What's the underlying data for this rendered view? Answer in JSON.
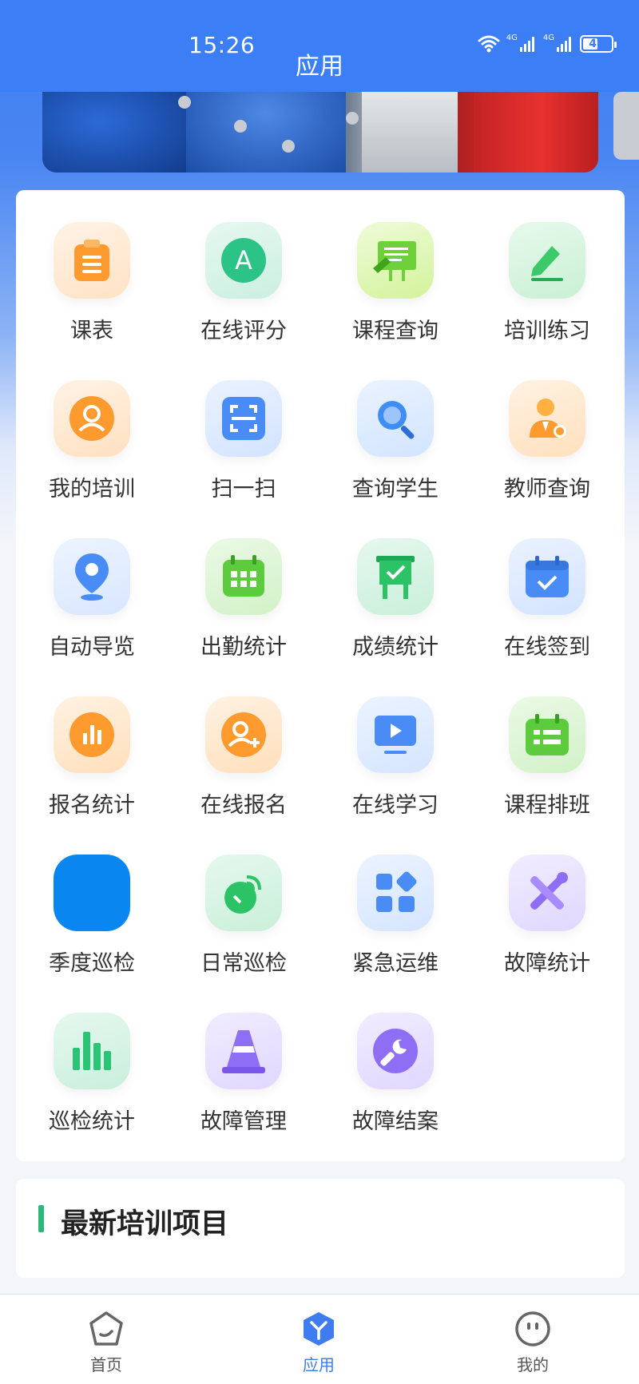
{
  "status": {
    "time": "15:26",
    "battery": "49",
    "net1": "4G",
    "net2": "4G"
  },
  "header": {
    "title": "应用"
  },
  "apps": [
    {
      "label": "课表",
      "icon": "clipboard-icon",
      "color": "#ff9a3c"
    },
    {
      "label": "在线评分",
      "icon": "grade-a-icon",
      "color": "#2bbf85"
    },
    {
      "label": "课程查询",
      "icon": "blackboard-icon",
      "color": "#79d43a"
    },
    {
      "label": "培训练习",
      "icon": "pencil-icon",
      "color": "#3cc36a"
    },
    {
      "label": "我的培训",
      "icon": "user-icon",
      "color": "#ff9a3c"
    },
    {
      "label": "扫一扫",
      "icon": "scan-icon",
      "color": "#4a8cf5"
    },
    {
      "label": "查询学生",
      "icon": "search-icon",
      "color": "#3f8ef5"
    },
    {
      "label": "教师查询",
      "icon": "teacher-icon",
      "color": "#ff9a3c"
    },
    {
      "label": "自动导览",
      "icon": "location-pin-icon",
      "color": "#4a8cf5"
    },
    {
      "label": "出勤统计",
      "icon": "calendar-grid-icon",
      "color": "#5ccb3d"
    },
    {
      "label": "成绩统计",
      "icon": "easel-check-icon",
      "color": "#2bbf65"
    },
    {
      "label": "在线签到",
      "icon": "calendar-check-icon",
      "color": "#4a8cf5"
    },
    {
      "label": "报名统计",
      "icon": "bar-chart-circle-icon",
      "color": "#ff9a3c"
    },
    {
      "label": "在线报名",
      "icon": "add-user-icon",
      "color": "#ff9a3c"
    },
    {
      "label": "在线学习",
      "icon": "video-play-icon",
      "color": "#4a8cf5"
    },
    {
      "label": "课程排班",
      "icon": "schedule-icon",
      "color": "#5ccb3d"
    },
    {
      "label": "季度巡检",
      "icon": "blue-square-icon",
      "color": "#0a86f0"
    },
    {
      "label": "日常巡检",
      "icon": "satellite-dish-icon",
      "color": "#2bbf65"
    },
    {
      "label": "紧急运维",
      "icon": "apps-grid-icon",
      "color": "#4a8cf5"
    },
    {
      "label": "故障统计",
      "icon": "tools-icon",
      "color": "#8e6ef5"
    },
    {
      "label": "巡检统计",
      "icon": "bar-chart-icon",
      "color": "#2bbf75"
    },
    {
      "label": "故障管理",
      "icon": "traffic-cone-icon",
      "color": "#8e6ef5"
    },
    {
      "label": "故障结案",
      "icon": "wrench-circle-icon",
      "color": "#8e6ef5"
    }
  ],
  "latest": {
    "title": "最新培训项目"
  },
  "tabs": [
    {
      "label": "首页",
      "icon": "home-icon"
    },
    {
      "label": "应用",
      "icon": "apps-hex-icon"
    },
    {
      "label": "我的",
      "icon": "profile-face-icon"
    }
  ]
}
